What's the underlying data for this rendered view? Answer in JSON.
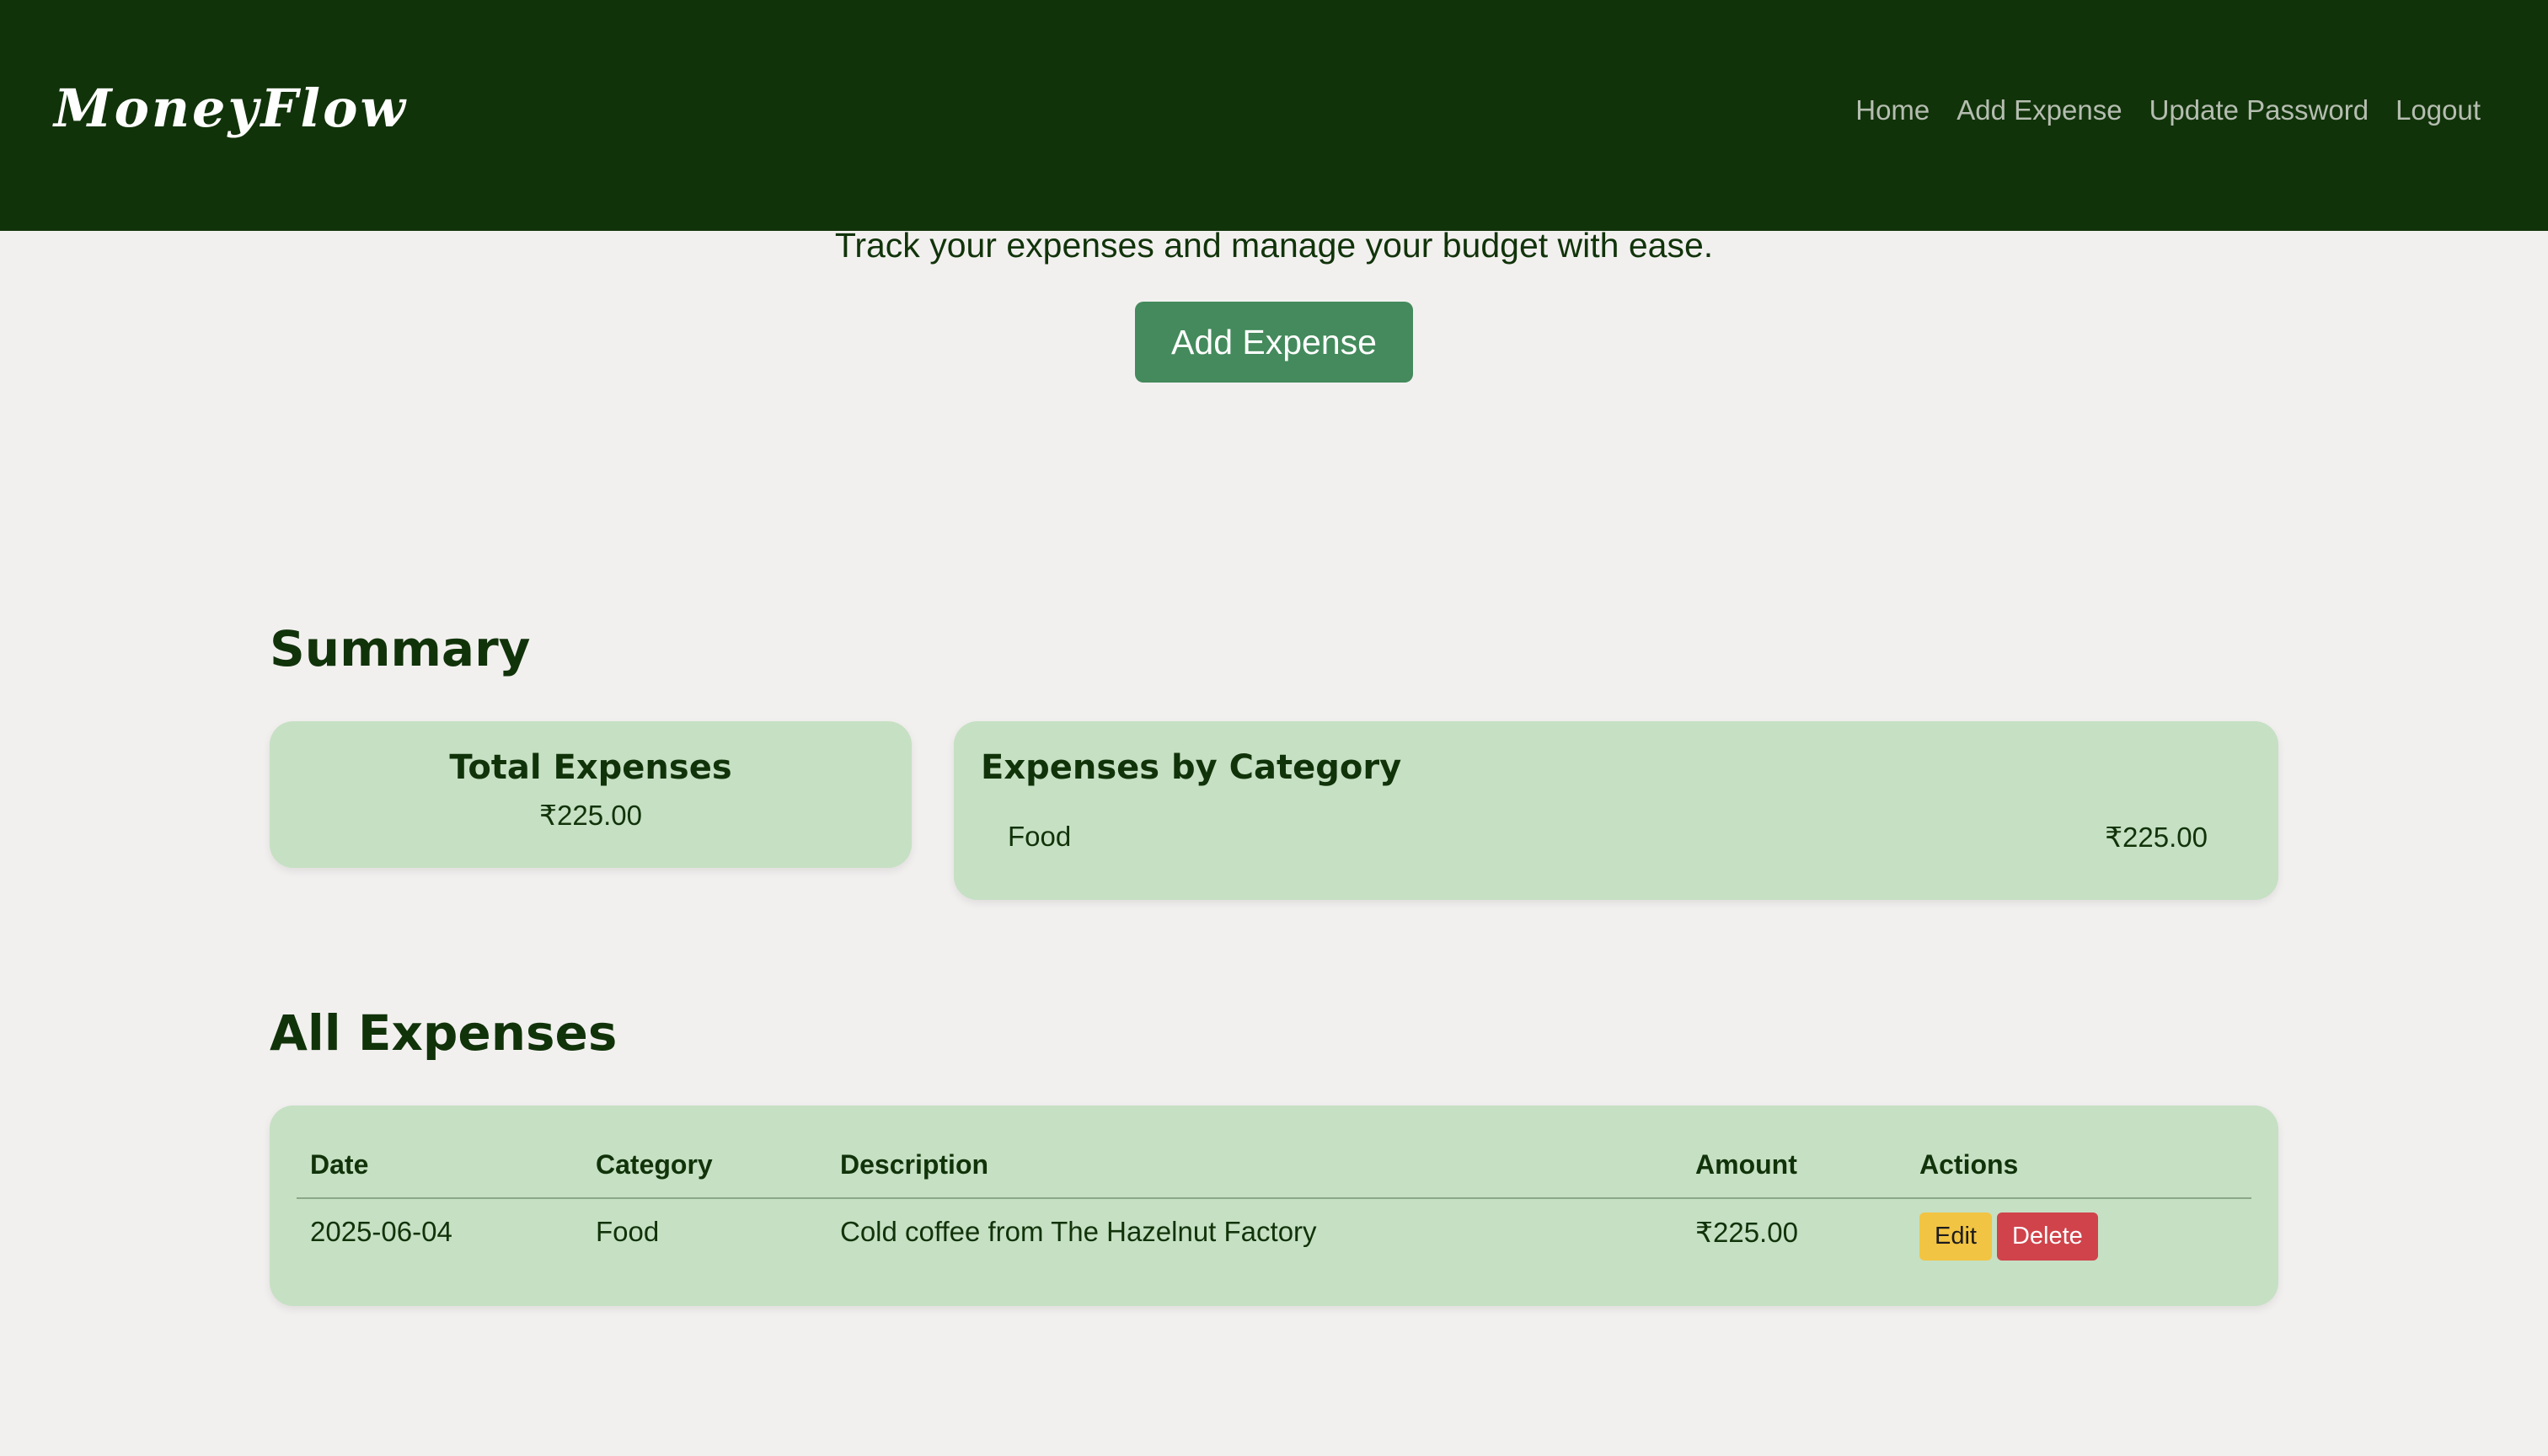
{
  "navbar": {
    "brand": "MoneyFlow",
    "links": [
      "Home",
      "Add Expense",
      "Update Password",
      "Logout"
    ]
  },
  "hero": {
    "tagline": "Track your expenses and manage your budget with ease.",
    "button_label": "Add Expense"
  },
  "summary": {
    "heading": "Summary",
    "total": {
      "title": "Total Expenses",
      "value": "₹225.00"
    },
    "by_category": {
      "title": "Expenses by Category",
      "items": [
        {
          "category": "Food",
          "amount": "₹225.00"
        }
      ]
    }
  },
  "expenses": {
    "heading": "All Expenses",
    "columns": [
      "Date",
      "Category",
      "Description",
      "Amount",
      "Actions"
    ],
    "rows": [
      {
        "date": "2025-06-04",
        "category": "Food",
        "description": "Cold coffee from The Hazelnut Factory",
        "amount": "₹225.00",
        "edit_label": "Edit",
        "delete_label": "Delete"
      }
    ]
  },
  "colors": {
    "navbar": "#11330a",
    "background": "#f2f0ef",
    "card": "#c6e0c3",
    "primary_button": "#448a5c",
    "edit_button": "#f2c443",
    "delete_button": "#d0434b"
  }
}
